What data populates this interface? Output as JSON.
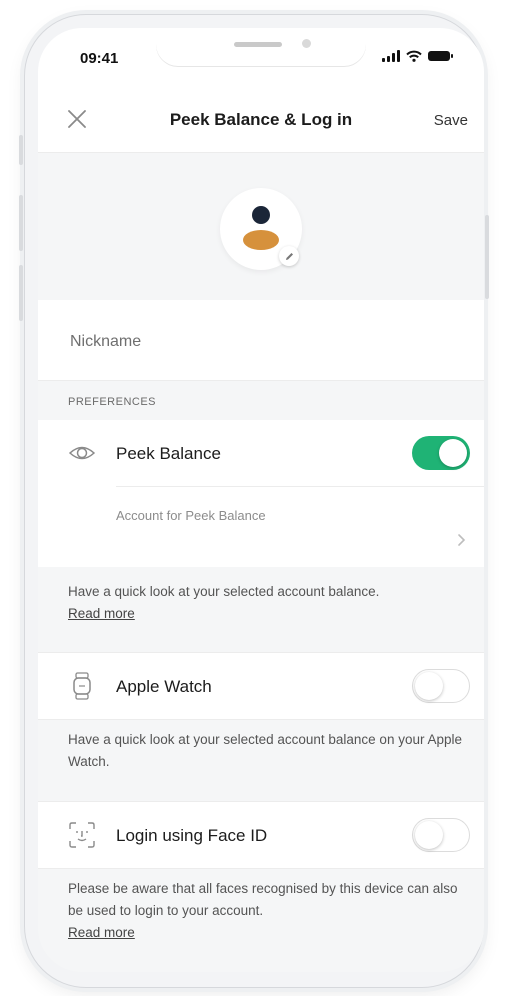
{
  "status_bar": {
    "time": "09:41"
  },
  "nav": {
    "title": "Peek Balance & Log in",
    "save_label": "Save"
  },
  "nickname": {
    "placeholder": "Nickname",
    "value": ""
  },
  "preferences": {
    "section_title": "PREFERENCES",
    "peek_balance": {
      "label": "Peek Balance",
      "enabled": true,
      "account_label": "Account for Peek Balance",
      "description": "Have a quick look at your selected account balance.",
      "read_more": "Read more"
    },
    "apple_watch": {
      "label": "Apple Watch",
      "enabled": false,
      "description": "Have a quick look at your selected account balance on your Apple Watch."
    },
    "face_id": {
      "label": "Login using Face ID",
      "enabled": false,
      "description": "Please be aware that all faces recognised by this device can also be used to login to your account.",
      "read_more": "Read more"
    }
  },
  "colors": {
    "accent_green": "#1fb375",
    "avatar_head": "#1b2638",
    "avatar_body": "#d6913c"
  },
  "icons": [
    "close-icon",
    "pencil-icon",
    "eye-icon",
    "watch-icon",
    "face-id-icon",
    "chevron-right-icon"
  ]
}
